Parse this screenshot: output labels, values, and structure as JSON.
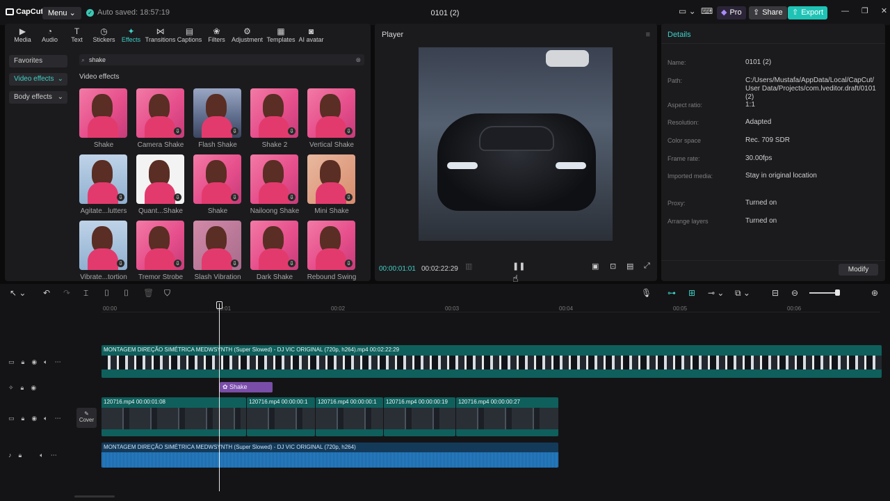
{
  "app": {
    "logo": "CapCut",
    "menu": "Menu",
    "autosave": "Auto saved: 18:57:19",
    "project_title": "0101 (2)",
    "pro": "Pro",
    "share": "Share",
    "export": "Export"
  },
  "toolbar": [
    {
      "label": "Media",
      "icon": "media-icon"
    },
    {
      "label": "Audio",
      "icon": "audio-icon"
    },
    {
      "label": "Text",
      "icon": "text-icon"
    },
    {
      "label": "Stickers",
      "icon": "sticker-icon"
    },
    {
      "label": "Effects",
      "icon": "effects-icon",
      "active": true
    },
    {
      "label": "Transitions",
      "icon": "transition-icon"
    },
    {
      "label": "Captions",
      "icon": "captions-icon"
    },
    {
      "label": "Filters",
      "icon": "filters-icon"
    },
    {
      "label": "Adjustment",
      "icon": "adjustment-icon"
    },
    {
      "label": "Templates",
      "icon": "templates-icon"
    },
    {
      "label": "AI avatar",
      "icon": "ai-avatar-icon"
    }
  ],
  "categories": [
    "Favorites",
    "Video effects",
    "Body effects"
  ],
  "search": {
    "value": "shake"
  },
  "section_title": "Video effects",
  "effects": [
    "Shake",
    "Camera Shake",
    "Flash Shake",
    "Shake 2",
    "Vertical Shake",
    "Agitate...lutters",
    "Quant...Shake",
    "Shake",
    "Nailoong Shake",
    "Mini Shake",
    "Vibrate...tortion",
    "Tremor Strobe",
    "Slash Vibration",
    "Dark Shake",
    "Rebound Swing"
  ],
  "player": {
    "title": "Player",
    "current": "00:00:01:01",
    "total": "00:02:22:29"
  },
  "details": {
    "title": "Details",
    "rows": [
      {
        "k": "Name:",
        "v": "0101 (2)"
      },
      {
        "k": "Path:",
        "v": "C:/Users/Mustafa/AppData/Local/CapCut/ User Data/Projects/com.lveditor.draft/0101 (2)"
      },
      {
        "k": "Aspect ratio:",
        "v": "1:1"
      },
      {
        "k": "Resolution:",
        "v": "Adapted"
      },
      {
        "k": "Color space",
        "v": "Rec. 709 SDR"
      },
      {
        "k": "Frame rate:",
        "v": "30.00fps"
      },
      {
        "k": "Imported media:",
        "v": "Stay in original location"
      },
      {
        "k": "Proxy:",
        "v": "Turned on"
      },
      {
        "k": "Arrange layers",
        "v": "Turned on"
      }
    ],
    "modify": "Modify"
  },
  "ruler": [
    "00:00",
    "00:01",
    "00:02",
    "00:03",
    "00:04",
    "00:05",
    "00:06"
  ],
  "tracks": {
    "top_clip": "MONTAGEM DIREÇÃO SIMÉTRICA MEDWSYNTH (Super Slowed) - DJ VIC ORIGINAL (720p, h264).mp4   00:02:22:29",
    "effect_clip": "Shake",
    "main_clips": [
      "120716.mp4   00:00:01:08",
      "120716.mp4   00:00:00:1",
      "120716.mp4   00:00:00:1",
      "120716.mp4   00:00:00:19",
      "120716.mp4   00:00:00:27"
    ],
    "cover": "Cover",
    "audio_clip": "MONTAGEM DIREÇÃO SIMÉTRICA MEDWSYNTH (Super Slowed) - DJ VIC ORIGINAL (720p, h264)"
  }
}
